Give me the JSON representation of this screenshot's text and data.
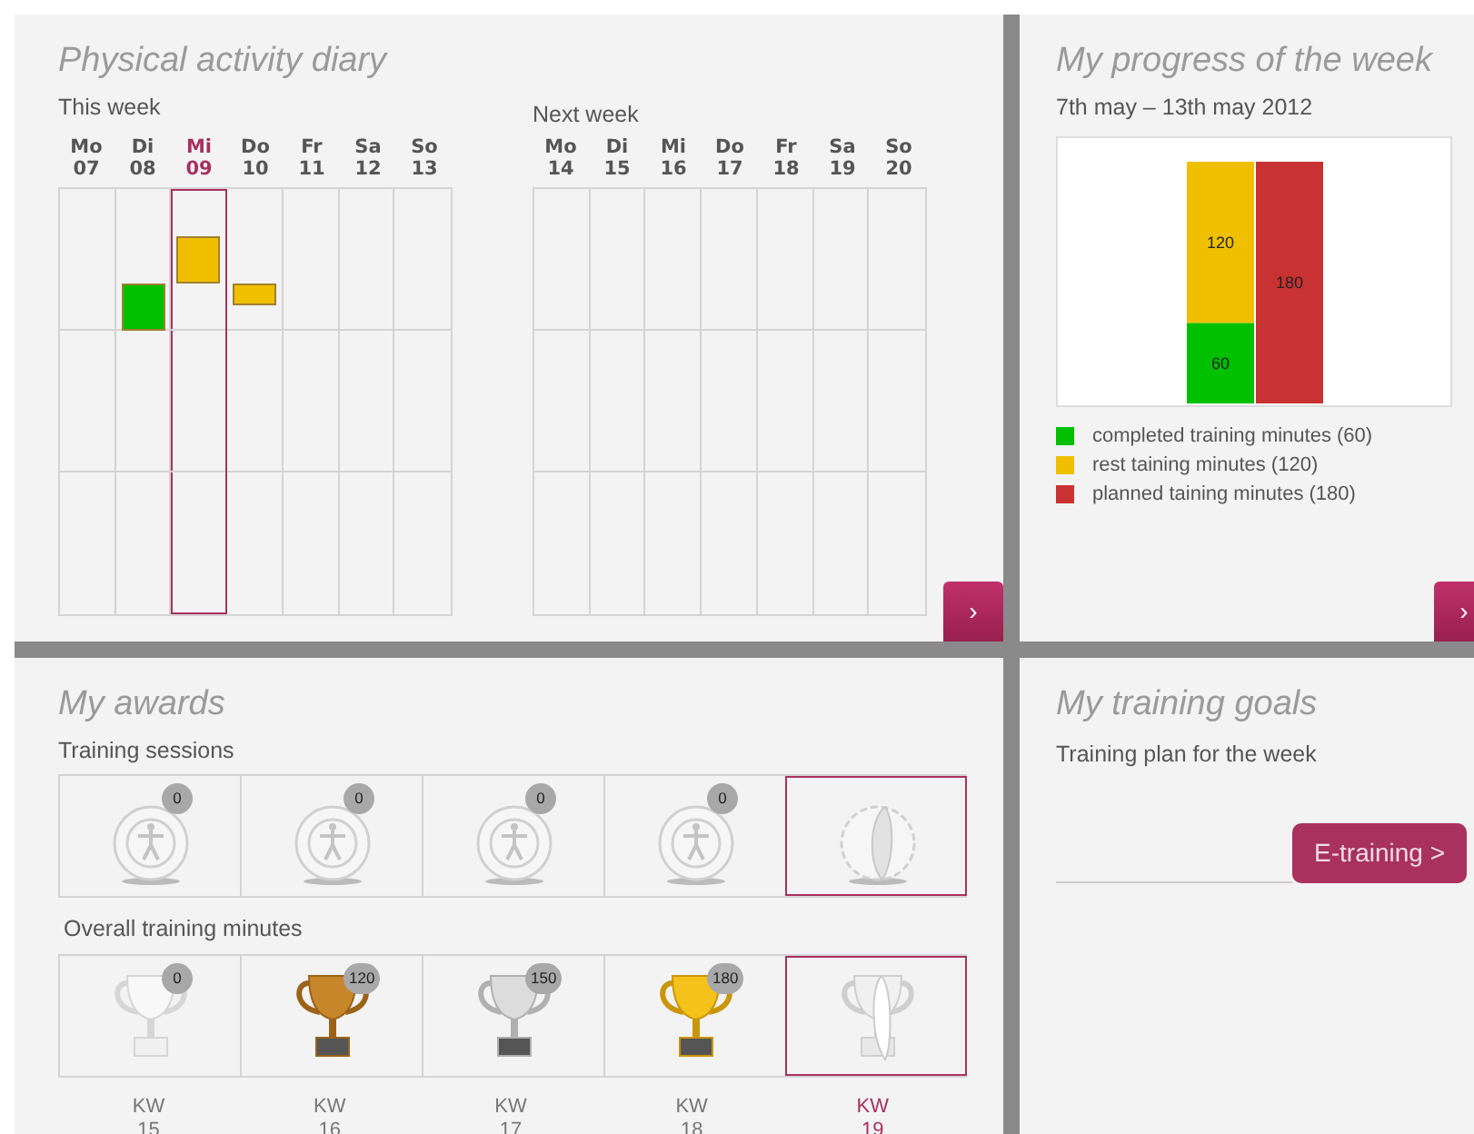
{
  "diary": {
    "title": "Physical activity diary",
    "weeks": [
      {
        "label": "This week",
        "days": [
          {
            "name": "Mo",
            "date": "07",
            "selected": false
          },
          {
            "name": "Di",
            "date": "08",
            "selected": false,
            "entries": [
              {
                "kind": "low",
                "color": "#00c000"
              }
            ]
          },
          {
            "name": "Mi",
            "date": "09",
            "selected": true,
            "entries": [
              {
                "kind": "high",
                "color": "#f0c000"
              }
            ]
          },
          {
            "name": "Do",
            "date": "10",
            "selected": false,
            "entries": [
              {
                "kind": "strip",
                "color": "#f0c000"
              }
            ]
          },
          {
            "name": "Fr",
            "date": "11",
            "selected": false
          },
          {
            "name": "Sa",
            "date": "12",
            "selected": false
          },
          {
            "name": "So",
            "date": "13",
            "selected": false
          }
        ]
      },
      {
        "label": "Next week",
        "days": [
          {
            "name": "Mo",
            "date": "14",
            "selected": false
          },
          {
            "name": "Di",
            "date": "15",
            "selected": false
          },
          {
            "name": "Mi",
            "date": "16",
            "selected": false
          },
          {
            "name": "Do",
            "date": "17",
            "selected": false
          },
          {
            "name": "Fr",
            "date": "18",
            "selected": false
          },
          {
            "name": "Sa",
            "date": "19",
            "selected": false
          },
          {
            "name": "So",
            "date": "20",
            "selected": false
          }
        ]
      }
    ],
    "next_button": "›"
  },
  "progress": {
    "title": "My progress of the week",
    "period": "7th may – 13th may 2012",
    "chart_data": {
      "type": "bar",
      "stacked": true,
      "data_labels": true,
      "series": [
        {
          "name": "completed training minutes (60)",
          "color": "#00c000",
          "values": [
            60,
            null
          ]
        },
        {
          "name": "rest taining minutes (120)",
          "color": "#f0c000",
          "values": [
            120,
            null
          ]
        },
        {
          "name": "planned taining minutes (180)",
          "color": "#c83232",
          "values": [
            null,
            180
          ]
        }
      ]
    },
    "next_button": "›"
  },
  "awards": {
    "title": "My awards",
    "rows": [
      {
        "label": "Training sessions",
        "items": [
          {
            "kind": "medal",
            "count": "0",
            "selected": false
          },
          {
            "kind": "medal",
            "count": "0",
            "selected": false
          },
          {
            "kind": "medal",
            "count": "0",
            "selected": false
          },
          {
            "kind": "medal",
            "count": "0",
            "selected": false
          },
          {
            "kind": "turning-medal",
            "selected": true
          }
        ]
      },
      {
        "label": "Overall training minutes",
        "items": [
          {
            "kind": "empty-cup",
            "count": "0",
            "selected": false
          },
          {
            "kind": "bronze-cup",
            "count": "120",
            "selected": false
          },
          {
            "kind": "silver-cup",
            "count": "150",
            "selected": false
          },
          {
            "kind": "gold-cup",
            "count": "180",
            "selected": false
          },
          {
            "kind": "turning-cup",
            "selected": true
          }
        ]
      }
    ],
    "weeks": [
      {
        "label": "KW",
        "number": "15",
        "selected": false
      },
      {
        "label": "KW",
        "number": "16",
        "selected": false
      },
      {
        "label": "KW",
        "number": "17",
        "selected": false
      },
      {
        "label": "KW",
        "number": "18",
        "selected": false
      },
      {
        "label": "KW",
        "number": "19",
        "selected": true
      }
    ]
  },
  "goals": {
    "title": "My training goals",
    "subtitle": "Training plan for the week",
    "button": "E-training >"
  }
}
